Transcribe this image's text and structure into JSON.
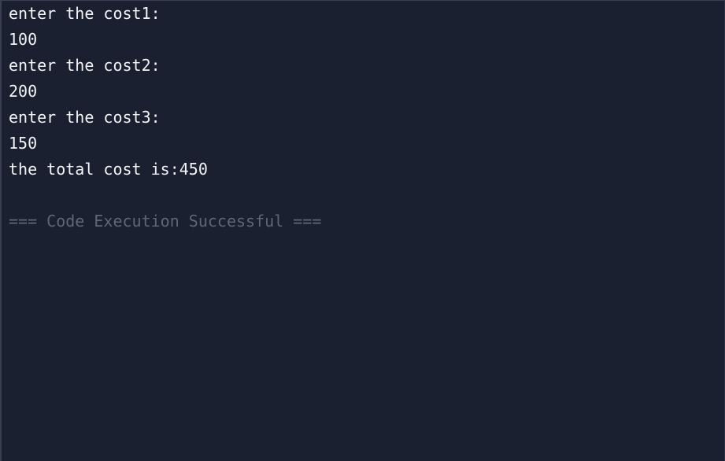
{
  "console": {
    "output_lines": [
      "enter the cost1:",
      "100",
      "enter the cost2:",
      "200",
      "enter the cost3:",
      "150",
      "the total cost is:450"
    ],
    "status_message": "=== Code Execution Successful ==="
  },
  "colors": {
    "background": "#1b2030",
    "text": "#f2f4f8",
    "status_text": "#5f6676"
  }
}
